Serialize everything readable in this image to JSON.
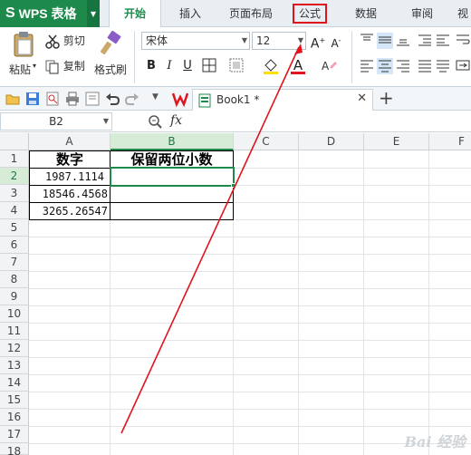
{
  "app": {
    "logo": "S",
    "name": "WPS 表格"
  },
  "tabs": [
    {
      "label": "开始",
      "active": true
    },
    {
      "label": "插入"
    },
    {
      "label": "页面布局"
    },
    {
      "label": "公式",
      "highlighted": true
    },
    {
      "label": "数据"
    },
    {
      "label": "审阅"
    },
    {
      "label": "视"
    }
  ],
  "ribbon": {
    "paste_label": "粘贴",
    "cut_label": "剪切",
    "copy_label": "复制",
    "format_painter_label": "格式刷",
    "font_name": "宋体",
    "font_size": "12",
    "bold": "B",
    "italic": "I",
    "underline": "U",
    "font_color_glyph": "A",
    "grow_font": "A",
    "shrink_font": "A"
  },
  "document_tab": {
    "title": "Book1 *"
  },
  "formula_bar": {
    "cell_ref": "B2",
    "fx_label": "fx"
  },
  "sheet": {
    "columns": [
      "A",
      "B",
      "C",
      "D",
      "E",
      "F"
    ],
    "rows": [
      "1",
      "2",
      "3",
      "4",
      "5",
      "6",
      "7",
      "8",
      "9",
      "10",
      "11",
      "12",
      "13",
      "14",
      "15",
      "16",
      "17",
      "18"
    ],
    "selected_cell": "B2",
    "cells": {
      "A1": "数字",
      "B1": "保留两位小数",
      "A2": "1987.1114",
      "A3": "18546.4568",
      "A4": "3265.26547",
      "B2": "",
      "B3": "",
      "B4": ""
    }
  },
  "watermark": "Bai 经验",
  "colors": {
    "brand_green": "#1d8a4b",
    "annotation_red": "#e0141e"
  }
}
